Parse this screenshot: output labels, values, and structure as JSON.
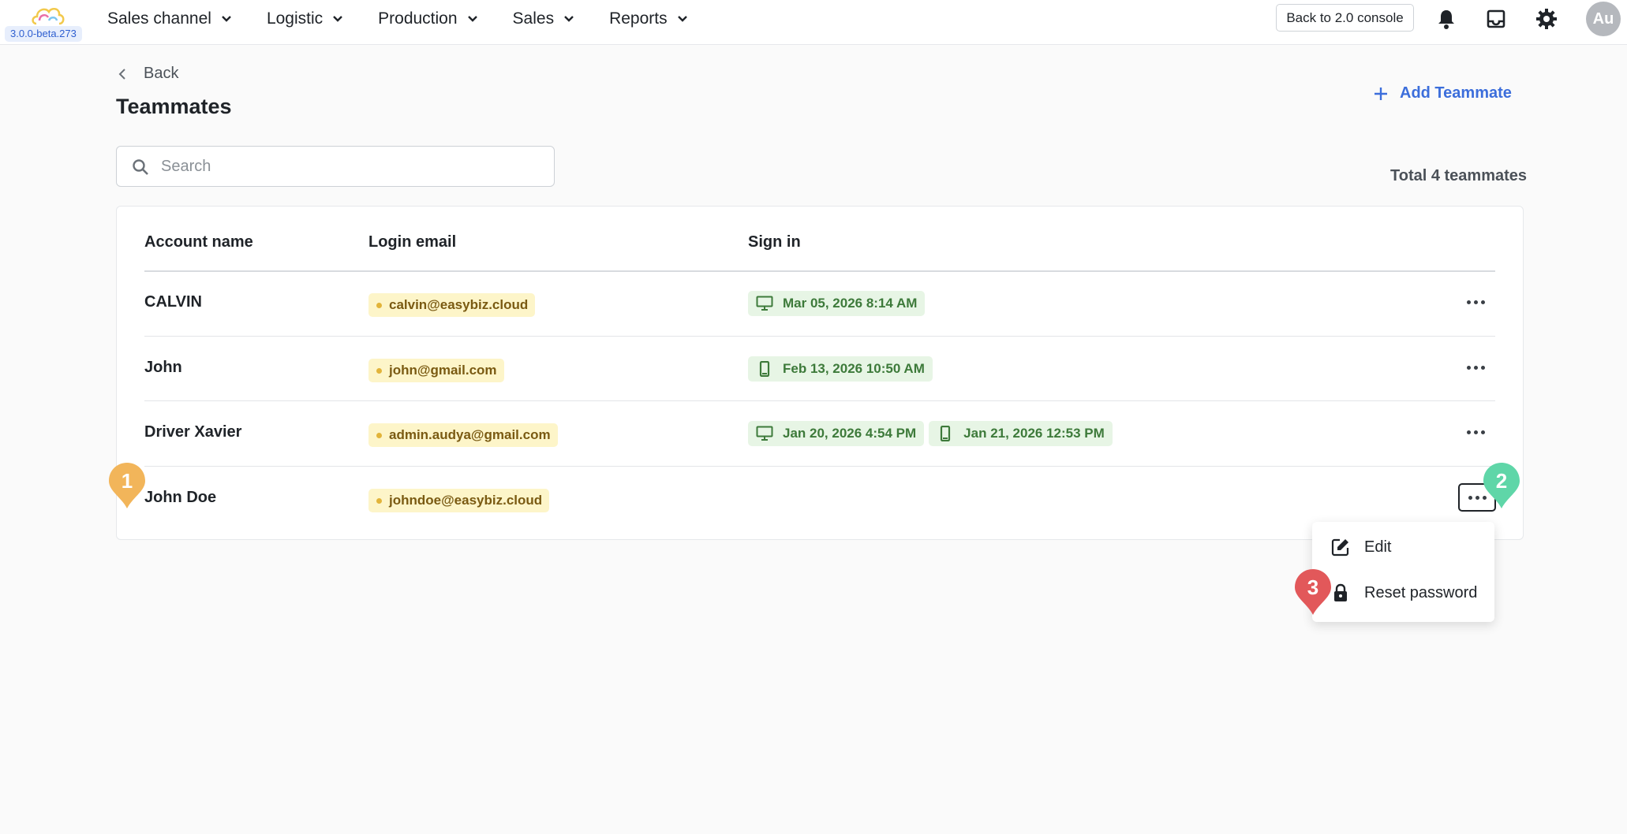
{
  "app": {
    "version": "3.0.0-beta.273"
  },
  "nav": {
    "items": [
      {
        "label": "Sales channel"
      },
      {
        "label": "Logistic"
      },
      {
        "label": "Production"
      },
      {
        "label": "Sales"
      },
      {
        "label": "Reports"
      }
    ],
    "console_button": "Back to 2.0 console",
    "icons": [
      "bell-icon",
      "inbox-icon",
      "gear-icon"
    ],
    "avatar_initials": "Au"
  },
  "page": {
    "back_label": "Back",
    "title": "Teammates",
    "add_button": "Add Teammate",
    "search_placeholder": "Search",
    "search_value": "",
    "total_label": "Total 4 teammates"
  },
  "table": {
    "columns": [
      "Account name",
      "Login email",
      "Sign in"
    ],
    "rows": [
      {
        "name": "CALVIN",
        "email": "calvin@easybiz.cloud",
        "sign_ins": [
          {
            "device": "desktop-icon",
            "time": "Mar 05, 2026 8:14 AM"
          }
        ]
      },
      {
        "name": "John",
        "email": "john@gmail.com",
        "sign_ins": [
          {
            "device": "mobile-icon",
            "time": "Feb 13, 2026 10:50 AM"
          }
        ]
      },
      {
        "name": "Driver Xavier",
        "email": "admin.audya@gmail.com",
        "sign_ins": [
          {
            "device": "desktop-icon",
            "time": "Jan 20, 2026 4:54 PM"
          },
          {
            "device": "mobile-icon",
            "time": "Jan 21, 2026 12:53 PM"
          }
        ]
      },
      {
        "name": "John Doe",
        "email": "johndoe@easybiz.cloud",
        "sign_ins": []
      }
    ]
  },
  "row_menu": {
    "items": [
      {
        "label": "Edit",
        "icon": "edit-icon"
      },
      {
        "label": "Reset password",
        "icon": "lock-icon"
      }
    ]
  },
  "markers": [
    {
      "number": "1",
      "color": "#f2b55a"
    },
    {
      "number": "2",
      "color": "#5fd6a8"
    },
    {
      "number": "3",
      "color": "#e2585a"
    }
  ],
  "colors": {
    "accent": "#3c6edb",
    "email_badge_bg": "#fdf5c9",
    "signin_badge_bg": "#e7f5e5"
  }
}
